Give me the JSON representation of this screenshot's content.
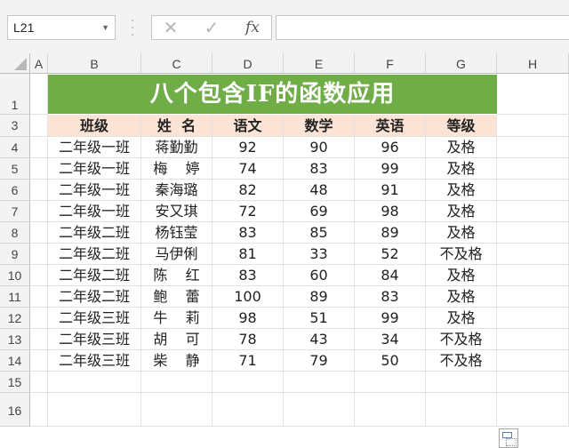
{
  "formula_bar": {
    "name_box": "L21",
    "cancel_symbol": "✕",
    "enter_symbol": "✓",
    "fx_label": "fx",
    "formula": ""
  },
  "columns": [
    "A",
    "B",
    "C",
    "D",
    "E",
    "F",
    "G",
    "H"
  ],
  "rows": [
    "1",
    "3",
    "4",
    "5",
    "6",
    "7",
    "8",
    "9",
    "10",
    "11",
    "12",
    "13",
    "14",
    "15",
    "16"
  ],
  "sheet": {
    "title": "八个包含IF的函数应用",
    "headers": [
      "班级",
      "姓  名",
      "语文",
      "数学",
      "英语",
      "等级"
    ],
    "data": [
      [
        "二年级一班",
        "蒋勤勤",
        "92",
        "90",
        "96",
        "及格"
      ],
      [
        "二年级一班",
        "梅    婷",
        "74",
        "83",
        "99",
        "及格"
      ],
      [
        "二年级一班",
        "秦海璐",
        "82",
        "48",
        "91",
        "及格"
      ],
      [
        "二年级一班",
        "安又琪",
        "72",
        "69",
        "98",
        "及格"
      ],
      [
        "二年级二班",
        "杨钰莹",
        "83",
        "85",
        "89",
        "及格"
      ],
      [
        "二年级二班",
        "马伊俐",
        "81",
        "33",
        "52",
        "不及格"
      ],
      [
        "二年级二班",
        "陈    红",
        "83",
        "60",
        "84",
        "及格"
      ],
      [
        "二年级二班",
        "鲍    蕾",
        "100",
        "89",
        "83",
        "及格"
      ],
      [
        "二年级三班",
        "牛    莉",
        "98",
        "51",
        "99",
        "及格"
      ],
      [
        "二年级三班",
        "胡    可",
        "78",
        "43",
        "34",
        "不及格"
      ],
      [
        "二年级三班",
        "柴    静",
        "71",
        "79",
        "50",
        "不及格"
      ]
    ]
  },
  "colors": {
    "title_fill": "#70ad47",
    "header_fill": "#fbe4d5",
    "title_text": "#ffffff"
  },
  "icons": {
    "paste_options": "paste-options-icon"
  }
}
